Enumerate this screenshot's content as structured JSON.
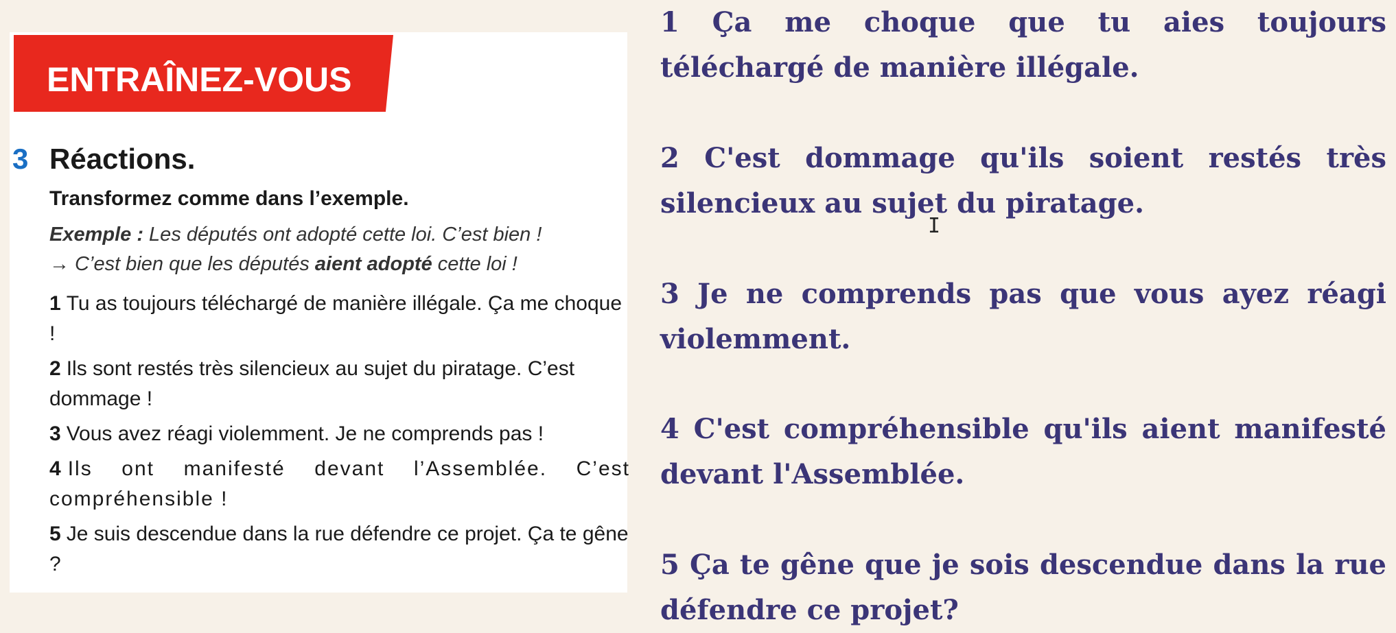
{
  "book": {
    "banner": "ENTRAÎNEZ-VOUS",
    "exercise_number": "3",
    "exercise_title": "Réactions.",
    "instruction": "Transformez comme dans l’exemple.",
    "example_label": "Exemple :",
    "example_text": " Les députés ont adopté cette loi. C’est bien !",
    "example_arrow": "→ C’est bien que les députés ",
    "example_bold": "aient adopté",
    "example_end": " cette loi !",
    "items": [
      {
        "n": "1",
        "text": "Tu as toujours téléchargé de manière illégale. Ça me choque !"
      },
      {
        "n": "2",
        "text": "Ils sont restés très silencieux au sujet du piratage. C’est dommage !"
      },
      {
        "n": "3",
        "text": "Vous avez réagi violemment. Je ne comprends pas !"
      },
      {
        "n": "4",
        "text": "Ils ont manifesté devant l’Assemblée. C’est compréhensible !"
      },
      {
        "n": "5",
        "text": "Je suis descendue dans la rue défendre ce projet. Ça te gêne ?"
      }
    ]
  },
  "answers": [
    "1 Ça me choque que tu aies toujours téléchargé de manière illégale.",
    "2 C'est dommage qu'ils soient restés très silencieux au sujet du piratage.",
    "3 Je ne comprends pas que vous ayez réagi violemment.",
    "4 C'est compréhensible qu'ils aient manifesté devant l'Assemblée.",
    "5 Ça te gêne que je sois descendue dans la rue défendre ce projet?"
  ],
  "colors": {
    "background": "#f7f1e8",
    "banner": "#e8281e",
    "exercise_number": "#1a6fc4",
    "answer_text": "#3b3577"
  },
  "icons": {
    "cursor": "text-cursor-icon"
  }
}
